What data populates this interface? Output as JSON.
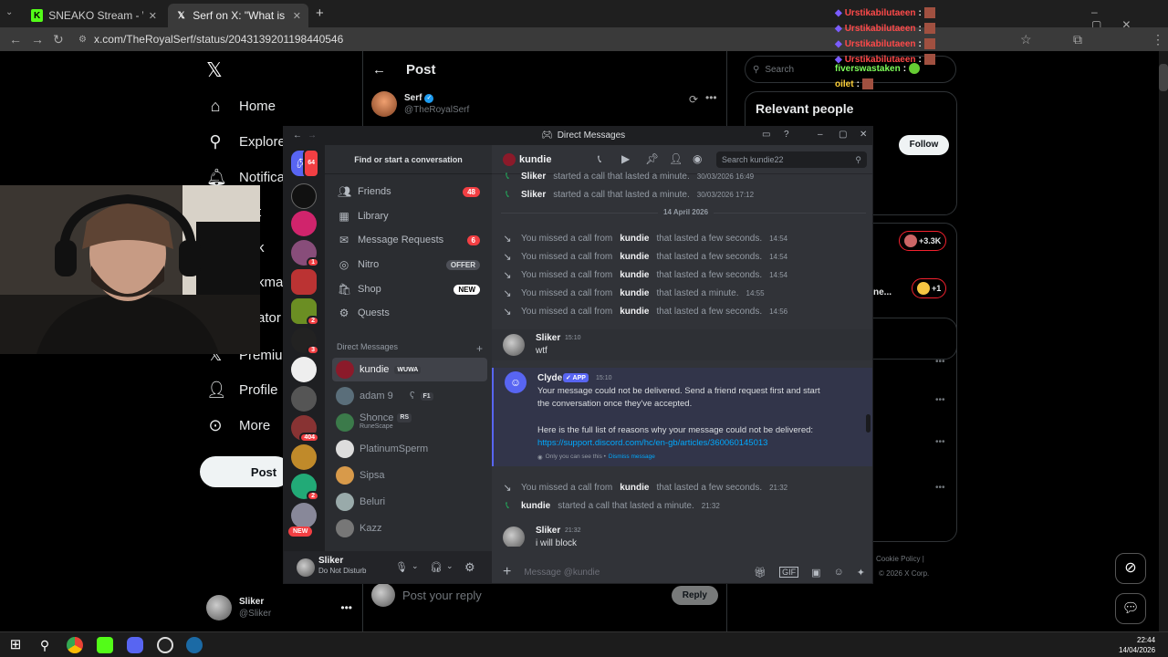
{
  "browser": {
    "tabs": [
      {
        "title": "SNEAKO Stream - Watch Live o",
        "close": "✕"
      },
      {
        "title": "Serf on X: \"What is Sydney Swe",
        "close": "✕"
      }
    ],
    "new_tab": "+",
    "url": "x.com/TheRoyalSerf/status/2043139201198440546"
  },
  "x": {
    "logo": "𝕏",
    "nav": [
      {
        "label": "Home",
        "icon": "home-icon"
      },
      {
        "label": "Explore",
        "icon": "search-icon"
      },
      {
        "label": "Notificat",
        "icon": "bell-icon"
      },
      {
        "label": "Premium",
        "icon": "x-logo-icon"
      },
      {
        "label": "Profile",
        "icon": "person-icon"
      },
      {
        "label": "More",
        "icon": "more-icon"
      }
    ],
    "post_button": "Post",
    "header_title": "Post",
    "author_name": "Serf",
    "author_handle": "@TheRoyalSerf",
    "search_placeholder": "Search",
    "relevant_people": "Relevant people",
    "follow": "Follow",
    "reply_placeholder": "Post your reply",
    "reply_button": "Reply",
    "footer": "Cookie Policy  |",
    "copyright": "© 2026 X Corp.",
    "counts": [
      "+3.3K",
      "+1"
    ],
    "account_name": "Sliker",
    "account_handle": "@Sliker",
    "partial": [
      "t",
      "k",
      "kma",
      "ator S",
      "ne..."
    ]
  },
  "overlay_chat": [
    {
      "name": "Urstikabilutaeen",
      "sep": ":"
    },
    {
      "name": "Urstikabilutaeen",
      "sep": ":"
    },
    {
      "name": "Urstikabilutaeen",
      "sep": ":"
    },
    {
      "name": "Urstikabilutaeen",
      "sep": ":"
    },
    {
      "name": "fiverswastaken",
      "sep": ":"
    },
    {
      "name": "oilet",
      "sep": ":"
    }
  ],
  "discord": {
    "window_title": "Direct Messages",
    "find": "Find or start a conversation",
    "menu": [
      {
        "label": "Friends",
        "badge": "48"
      },
      {
        "label": "Library",
        "badge": ""
      },
      {
        "label": "Message Requests",
        "badge": "6"
      },
      {
        "label": "Nitro",
        "badge": "OFFER"
      },
      {
        "label": "Shop",
        "badge": "NEW"
      },
      {
        "label": "Quests",
        "badge": ""
      }
    ],
    "dm_header": "Direct Messages",
    "dm_add": "+",
    "dms": [
      {
        "name": "kundie",
        "tag": "WUWA",
        "sub": ""
      },
      {
        "name": "adam 9      ʕ",
        "tag": "F1",
        "sub": ""
      },
      {
        "name": "Shonce",
        "tag": "RS",
        "sub": "RuneScape"
      },
      {
        "name": "PlatinumSperm",
        "tag": "",
        "sub": ""
      },
      {
        "name": "Sipsa",
        "tag": "",
        "sub": ""
      },
      {
        "name": "Beluri",
        "tag": "",
        "sub": ""
      },
      {
        "name": "Kazz",
        "tag": "",
        "sub": ""
      }
    ],
    "guild_badges": [
      "64",
      "1",
      "2",
      "3",
      "404",
      "2"
    ],
    "guild_new": "NEW",
    "user": {
      "name": "Sliker",
      "status": "Do Not Disturb"
    },
    "chat_name": "kundie",
    "search_placeholder": "Search kundie22",
    "date_divider": "14 April 2026",
    "calls_top": [
      {
        "text_a": "",
        "who": "Sliker",
        "text_b": "started a call that lasted a minute.",
        "time": "30/03/2026 16:49"
      },
      {
        "text_a": "",
        "who": "Sliker",
        "text_b": "started a call that lasted a minute.",
        "time": "30/03/2026 17:12"
      }
    ],
    "missed": [
      {
        "text_a": "You missed a call from",
        "who": "kundie",
        "text_b": "that lasted a few seconds.",
        "time": "14:54"
      },
      {
        "text_a": "You missed a call from",
        "who": "kundie",
        "text_b": "that lasted a few seconds.",
        "time": "14:54"
      },
      {
        "text_a": "You missed a call from",
        "who": "kundie",
        "text_b": "that lasted a few seconds.",
        "time": "14:54"
      },
      {
        "text_a": "You missed a call from",
        "who": "kundie",
        "text_b": "that lasted a minute.",
        "time": "14:55"
      },
      {
        "text_a": "You missed a call from",
        "who": "kundie",
        "text_b": "that lasted a few seconds.",
        "time": "14:56"
      }
    ],
    "msg1": {
      "author": "Sliker",
      "time": "15:10",
      "text": "wtf"
    },
    "clyde": {
      "author": "Clyde",
      "badge": "✓ APP",
      "time": "15:10",
      "line1": "Your message could not be delivered. Send a friend request first and start",
      "line2": "the conversation once they've accepted.",
      "line3": "Here is the full list of reasons why your message could not be delivered:",
      "link": "https://support.discord.com/hc/en-gb/articles/360060145013",
      "note": "Only you can see this •",
      "dismiss": "Dismiss message"
    },
    "calls_bottom": [
      {
        "text_a": "You missed a call from",
        "who": "kundie",
        "text_b": "that lasted a few seconds.",
        "time": "21:32"
      },
      {
        "text_a": "",
        "who": "kundie",
        "text_b": "started a call that lasted a minute.",
        "time": "21:32"
      }
    ],
    "msg2": {
      "author": "Sliker",
      "time": "21:32",
      "text": "i will block"
    },
    "composer_placeholder": "Message @kundie"
  },
  "taskbar": {
    "time": "22:44",
    "date": "14/04/2026"
  }
}
